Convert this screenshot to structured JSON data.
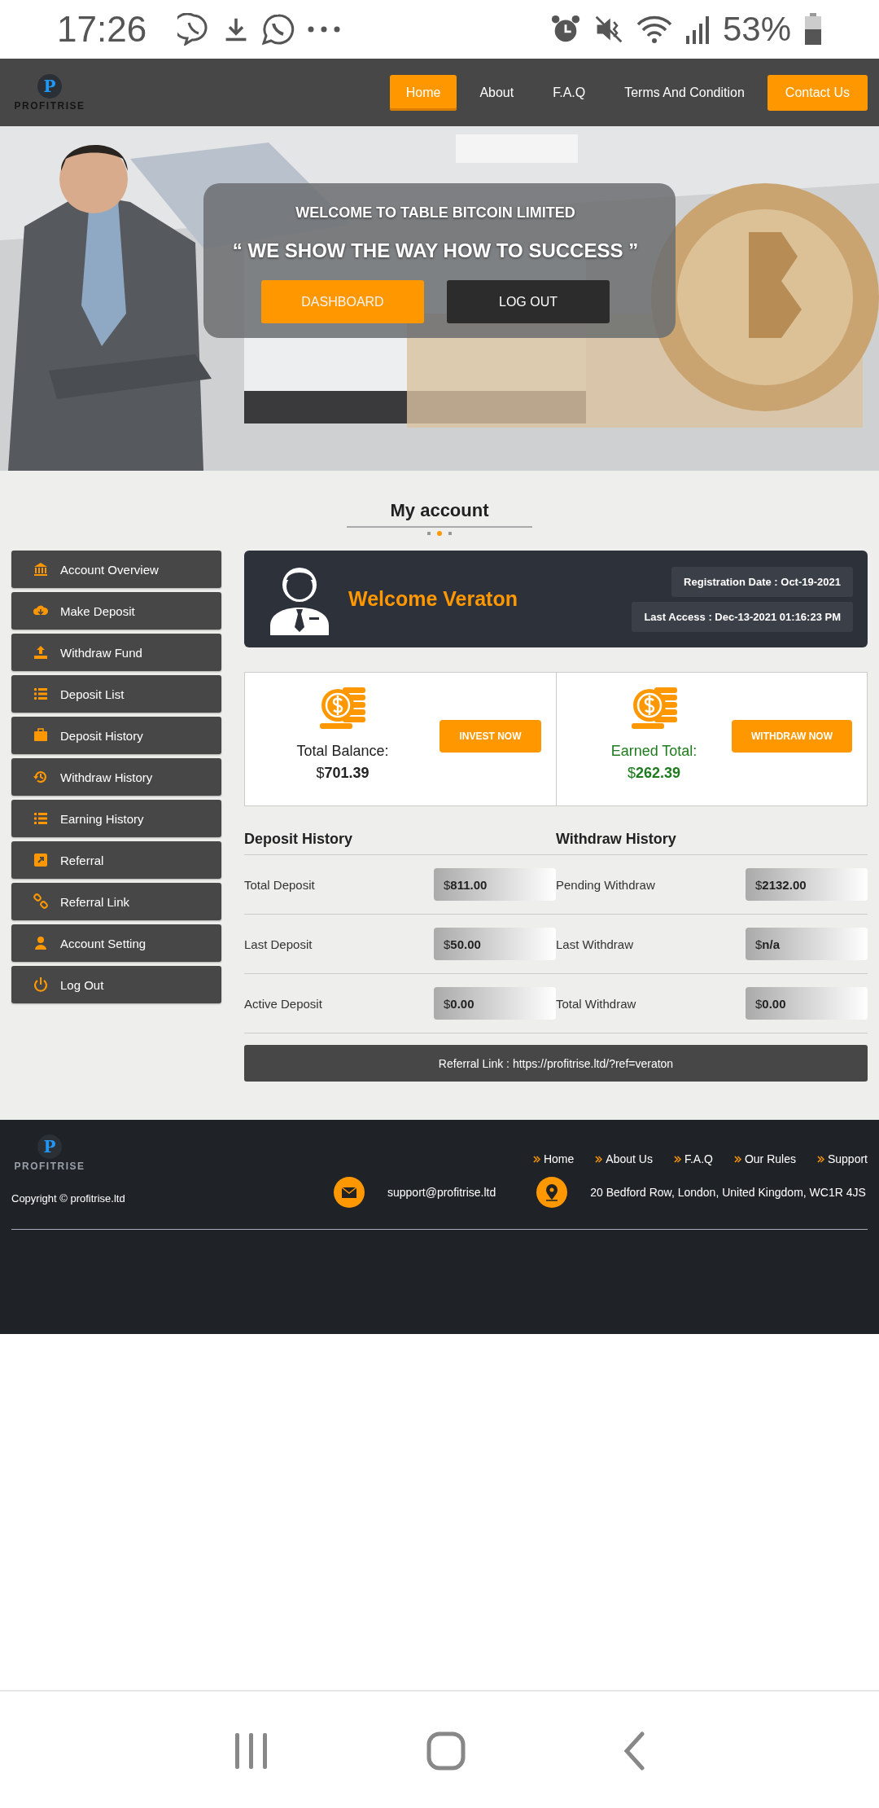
{
  "status_bar": {
    "time": "17:26",
    "battery": "53%"
  },
  "nav": {
    "logo_letter": "P",
    "logo_text": "PROFITRISE",
    "items": [
      {
        "label": "Home",
        "selected": true,
        "kind": "link"
      },
      {
        "label": "About",
        "selected": false,
        "kind": "link"
      },
      {
        "label": "F.A.Q",
        "selected": false,
        "kind": "link"
      },
      {
        "label": "Terms And Condition",
        "selected": false,
        "kind": "link"
      },
      {
        "label": "Contact Us",
        "selected": false,
        "kind": "button"
      }
    ]
  },
  "hero": {
    "kicker": "WELCOME TO TABLE BITCOIN LIMITED",
    "headline": "“ WE SHOW THE WAY HOW TO SUCCESS ”",
    "buttons": [
      {
        "label": "DASHBOARD",
        "kind": "primary"
      },
      {
        "label": "LOG OUT",
        "kind": "dark"
      }
    ]
  },
  "account": {
    "title": "My account"
  },
  "sidebar": {
    "items": [
      {
        "label": "Account Overview"
      },
      {
        "label": "Make Deposit"
      },
      {
        "label": "Withdraw Fund"
      },
      {
        "label": "Deposit List"
      },
      {
        "label": "Deposit History"
      },
      {
        "label": "Withdraw History"
      },
      {
        "label": "Earning History"
      },
      {
        "label": "Referral"
      },
      {
        "label": "Referral Link"
      },
      {
        "label": "Account Setting"
      },
      {
        "label": "Log Out"
      }
    ]
  },
  "welcome": {
    "greeting": "Welcome Veraton",
    "registration": "Registration Date : Oct-19-2021",
    "last_access": "Last Access : Dec-13-2021 01:16:23 PM"
  },
  "balances": [
    {
      "label": "Total Balance:",
      "currency": "$",
      "amount": "701.39",
      "button": "INVEST NOW",
      "color": "#222222"
    },
    {
      "label": "Earned Total:",
      "currency": "$",
      "amount": "262.39",
      "button": "WITHDRAW NOW",
      "color": "#1e7b1e"
    }
  ],
  "histories": [
    {
      "title": "Deposit History",
      "rows": [
        {
          "label": "Total Deposit",
          "currency": "$",
          "value": "811.00"
        },
        {
          "label": "Last Deposit",
          "currency": "$",
          "value": "50.00"
        },
        {
          "label": "Active Deposit",
          "currency": "$",
          "value": "0.00"
        }
      ]
    },
    {
      "title": "Withdraw History",
      "rows": [
        {
          "label": "Pending Withdraw",
          "currency": "$",
          "value": "2132.00"
        },
        {
          "label": "Last Withdraw",
          "currency": "$",
          "value": "n/a"
        },
        {
          "label": "Total Withdraw",
          "currency": "$",
          "value": "0.00"
        }
      ]
    }
  ],
  "referral_link": "Referral Link : https://profitrise.ltd/?ref=veraton",
  "footer": {
    "logo_letter": "P",
    "logo_text": "PROFITRISE",
    "links": [
      "Home",
      "About Us",
      "F.A.Q",
      "Our Rules",
      "Support"
    ],
    "copyright": "Copyright © profitrise.ltd",
    "email": "support@profitrise.ltd",
    "address": "20 Bedford Row, London, United Kingdom, WC1R 4JS"
  }
}
